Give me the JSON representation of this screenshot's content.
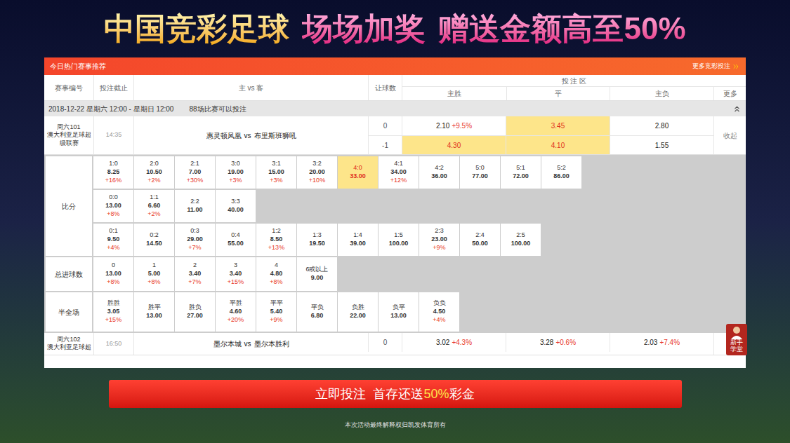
{
  "banner": {
    "parts": [
      {
        "text": "中国竞彩足球",
        "kind": "gold"
      },
      {
        "text": "场场加奖",
        "kind": "pink"
      },
      {
        "text": "赠送金额高至50%",
        "kind": "pink"
      }
    ]
  },
  "panel": {
    "title": "今日热门赛事推荐",
    "more_link": "更多竞彩投注"
  },
  "columns": [
    "赛事编号",
    "投注截止",
    "主 vs 客",
    "让球数"
  ],
  "bet_area": {
    "label": "投 注 区",
    "columns": [
      "主胜",
      "平",
      "主负"
    ],
    "more": "更多"
  },
  "date_group": {
    "text": "2018-12-22 星期六 12:00 - 星期日 12:00",
    "count": "88场比赛可以投注",
    "expanded": true
  },
  "matches": [
    {
      "code": "周六101",
      "league": "澳大利亚足球超级联赛",
      "deadline": "14:35",
      "home": "惠灵顿凤凰",
      "vs": "vs",
      "away": "布里斯班狮吼",
      "action": "收起",
      "expanded": true,
      "lines": [
        {
          "handicap": "0",
          "odds": [
            {
              "value": "2.10",
              "bonus": "+9.5%",
              "selected": false
            },
            {
              "value": "3.45",
              "bonus": "",
              "selected": true
            },
            {
              "value": "2.80",
              "bonus": "",
              "selected": false
            }
          ]
        },
        {
          "handicap": "-1",
          "odds": [
            {
              "value": "4.30",
              "bonus": "",
              "selected": true
            },
            {
              "value": "4.10",
              "bonus": "",
              "selected": true
            },
            {
              "value": "1.55",
              "bonus": "",
              "selected": false
            }
          ]
        }
      ]
    },
    {
      "code": "周六102",
      "league": "澳大利亚足球超",
      "deadline": "16:50",
      "home": "墨尔本城",
      "vs": "vs",
      "away": "墨尔本胜利",
      "action": "",
      "expanded": false,
      "lines": [
        {
          "handicap": "0",
          "odds": [
            {
              "value": "3.02",
              "bonus": "+4.3%",
              "selected": false
            },
            {
              "value": "3.28",
              "bonus": "+0.6%",
              "selected": false
            },
            {
              "value": "2.03",
              "bonus": "+7.4%",
              "selected": false
            }
          ]
        }
      ]
    }
  ],
  "details": [
    {
      "label": "比分",
      "rows": [
        [
          {
            "label": "1:0",
            "odds": "8.25",
            "bonus": "+16%",
            "selected": false
          },
          {
            "label": "2:0",
            "odds": "10.50",
            "bonus": "+2%",
            "selected": false
          },
          {
            "label": "2:1",
            "odds": "7.00",
            "bonus": "+30%",
            "selected": false
          },
          {
            "label": "3:0",
            "odds": "19.00",
            "bonus": "+3%",
            "selected": false
          },
          {
            "label": "3:1",
            "odds": "15.00",
            "bonus": "+3%",
            "selected": false
          },
          {
            "label": "3:2",
            "odds": "20.00",
            "bonus": "+10%",
            "selected": false
          },
          {
            "label": "4:0",
            "odds": "33.00",
            "bonus": "",
            "selected": true
          },
          {
            "label": "4:1",
            "odds": "34.00",
            "bonus": "+12%",
            "selected": false
          },
          {
            "label": "4:2",
            "odds": "36.00",
            "bonus": "",
            "selected": false
          },
          {
            "label": "5:0",
            "odds": "77.00",
            "bonus": "",
            "selected": false
          },
          {
            "label": "5:1",
            "odds": "72.00",
            "bonus": "",
            "selected": false
          },
          {
            "label": "5:2",
            "odds": "86.00",
            "bonus": "",
            "selected": false
          }
        ],
        [
          {
            "label": "0:0",
            "odds": "13.00",
            "bonus": "+8%",
            "selected": false
          },
          {
            "label": "1:1",
            "odds": "6.60",
            "bonus": "+2%",
            "selected": false
          },
          {
            "label": "2:2",
            "odds": "11.00",
            "bonus": "",
            "selected": false
          },
          {
            "label": "3:3",
            "odds": "40.00",
            "bonus": "",
            "selected": false
          }
        ],
        [
          {
            "label": "0:1",
            "odds": "9.50",
            "bonus": "+4%",
            "selected": false
          },
          {
            "label": "0:2",
            "odds": "14.50",
            "bonus": "",
            "selected": false
          },
          {
            "label": "0:3",
            "odds": "29.00",
            "bonus": "+7%",
            "selected": false
          },
          {
            "label": "0:4",
            "odds": "55.00",
            "bonus": "",
            "selected": false
          },
          {
            "label": "1:2",
            "odds": "8.50",
            "bonus": "+13%",
            "selected": false
          },
          {
            "label": "1:3",
            "odds": "19.50",
            "bonus": "",
            "selected": false
          },
          {
            "label": "1:4",
            "odds": "39.00",
            "bonus": "",
            "selected": false
          },
          {
            "label": "1:5",
            "odds": "100.00",
            "bonus": "",
            "selected": false
          },
          {
            "label": "2:3",
            "odds": "23.00",
            "bonus": "+9%",
            "selected": false
          },
          {
            "label": "2:4",
            "odds": "50.00",
            "bonus": "",
            "selected": false
          },
          {
            "label": "2:5",
            "odds": "100.00",
            "bonus": "",
            "selected": false
          }
        ]
      ]
    },
    {
      "label": "总进球数",
      "rows": [
        [
          {
            "label": "0",
            "odds": "13.00",
            "bonus": "+8%",
            "selected": false
          },
          {
            "label": "1",
            "odds": "5.00",
            "bonus": "+8%",
            "selected": false
          },
          {
            "label": "2",
            "odds": "3.40",
            "bonus": "+7%",
            "selected": false
          },
          {
            "label": "3",
            "odds": "3.40",
            "bonus": "+15%",
            "selected": false
          },
          {
            "label": "4",
            "odds": "4.80",
            "bonus": "+8%",
            "selected": false
          },
          {
            "label": "6或以上",
            "odds": "9.00",
            "bonus": "",
            "selected": false
          }
        ]
      ]
    },
    {
      "label": "半全场",
      "rows": [
        [
          {
            "label": "胜胜",
            "odds": "3.05",
            "bonus": "+15%",
            "selected": false
          },
          {
            "label": "胜平",
            "odds": "13.00",
            "bonus": "",
            "selected": false
          },
          {
            "label": "胜负",
            "odds": "27.00",
            "bonus": "",
            "selected": false
          },
          {
            "label": "平胜",
            "odds": "4.60",
            "bonus": "+20%",
            "selected": false
          },
          {
            "label": "平平",
            "odds": "5.40",
            "bonus": "+9%",
            "selected": false
          },
          {
            "label": "平负",
            "odds": "6.80",
            "bonus": "",
            "selected": false
          },
          {
            "label": "负胜",
            "odds": "22.00",
            "bonus": "",
            "selected": false
          },
          {
            "label": "负平",
            "odds": "13.00",
            "bonus": "",
            "selected": false
          },
          {
            "label": "负负",
            "odds": "4.50",
            "bonus": "+4%",
            "selected": false
          }
        ]
      ]
    }
  ],
  "side_badge": {
    "label": "新手学堂"
  },
  "cta": {
    "parts": [
      {
        "text": "立即投注",
        "highlight": false
      },
      {
        "text": "首存还送",
        "highlight": false
      },
      {
        "text": "50%",
        "highlight": true
      },
      {
        "text": "彩金",
        "highlight": false
      }
    ]
  },
  "footer": "本次活动最终解释权归凯发体育所有"
}
